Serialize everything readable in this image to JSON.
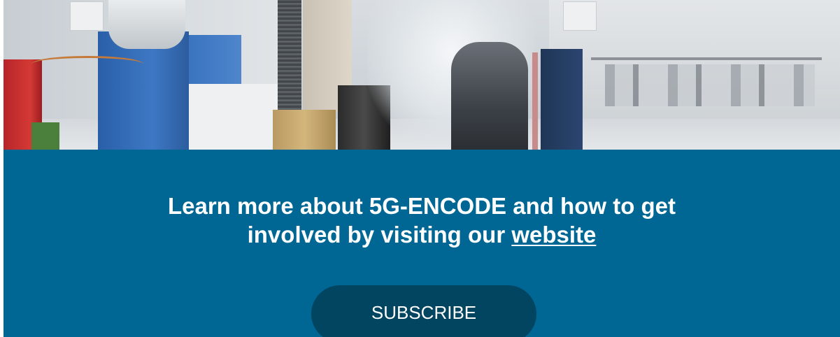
{
  "hero": {
    "image_description_icon": "lab-photo"
  },
  "cta": {
    "text_line1": "Learn more about 5G-ENCODE and how to get",
    "text_line2_prefix": "involved by visiting our ",
    "link_label": "website",
    "subscribe_label": "SUBSCRIBE"
  },
  "colors": {
    "band_background": "#006794",
    "button_background": "#014561",
    "text": "#ffffff"
  }
}
